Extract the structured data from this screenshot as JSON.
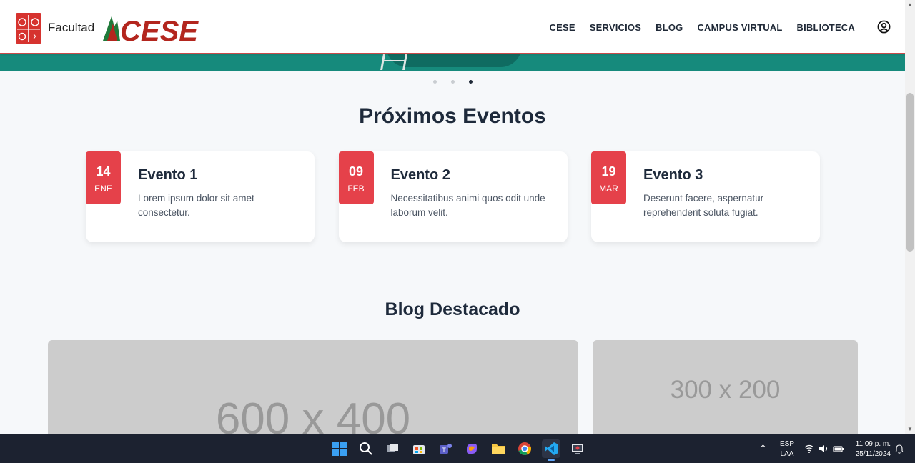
{
  "header": {
    "logo_text": "Facultad",
    "brand_text": "CESE",
    "nav": [
      "CESE",
      "SERVICIOS",
      "BLOG",
      "CAMPUS VIRTUAL",
      "BIBLIOTECA"
    ]
  },
  "carousel": {
    "slides": 3,
    "active_index": 2
  },
  "events_section": {
    "title": "Próximos Eventos",
    "events": [
      {
        "day": "14",
        "month": "ENE",
        "title": "Evento 1",
        "description": "Lorem ipsum dolor sit amet consectetur."
      },
      {
        "day": "09",
        "month": "FEB",
        "title": "Evento 2",
        "description": "Necessitatibus animi quos odit unde laborum velit."
      },
      {
        "day": "19",
        "month": "MAR",
        "title": "Evento 3",
        "description": "Deserunt facere, aspernatur reprehenderit soluta fugiat."
      }
    ]
  },
  "blog_section": {
    "title": "Blog Destacado",
    "placeholders": [
      "600 x 400",
      "300 x 200"
    ]
  },
  "taskbar": {
    "language": "ESP",
    "layout": "LAA",
    "time": "11:09 p. m.",
    "date": "25/11/2024"
  },
  "colors": {
    "accent": "#e5414a",
    "hero": "#168a7c",
    "text": "#1e2a3b"
  }
}
